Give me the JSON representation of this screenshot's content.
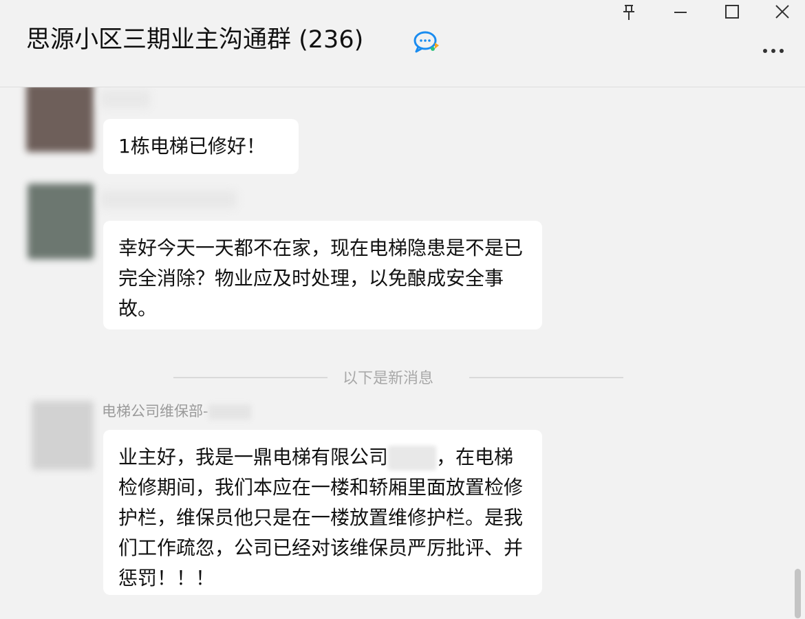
{
  "header": {
    "title": "思源小区三期业主沟通群 (236)",
    "chat_icon": "group-chat-icon"
  },
  "window_controls": {
    "icons": [
      "pin-icon",
      "minimize-icon",
      "maximize-icon",
      "close-icon",
      "more-icon"
    ]
  },
  "messages": [
    {
      "sender": "",
      "text": "1栋电梯已修好！"
    },
    {
      "sender": "",
      "text": "幸好今天一天都不在家，现在电梯隐患是不是已完全消除？物业应及时处理，以免酿成安全事故。"
    }
  ],
  "divider": {
    "label": "以下是新消息"
  },
  "new_message": {
    "sender": "电梯公司维保部-",
    "text_part1": "业主好，我是一鼎电梯有限公司",
    "text_part2": "，在电梯检修期间，我们本应在一楼和轿厢里面放置检修护栏，维保员他只是在一楼放置维修护栏。是我们工作疏忽，公司已经对该维保员严厉批评、并惩罚！！！"
  },
  "colors": {
    "background": "#f2f2f2",
    "bubble": "#ffffff",
    "divider_text": "#a8a8a8",
    "sender_text": "#9a9a9a",
    "chat_icon_blue": "#1a8cf0",
    "chat_icon_orange": "#f6a623"
  }
}
